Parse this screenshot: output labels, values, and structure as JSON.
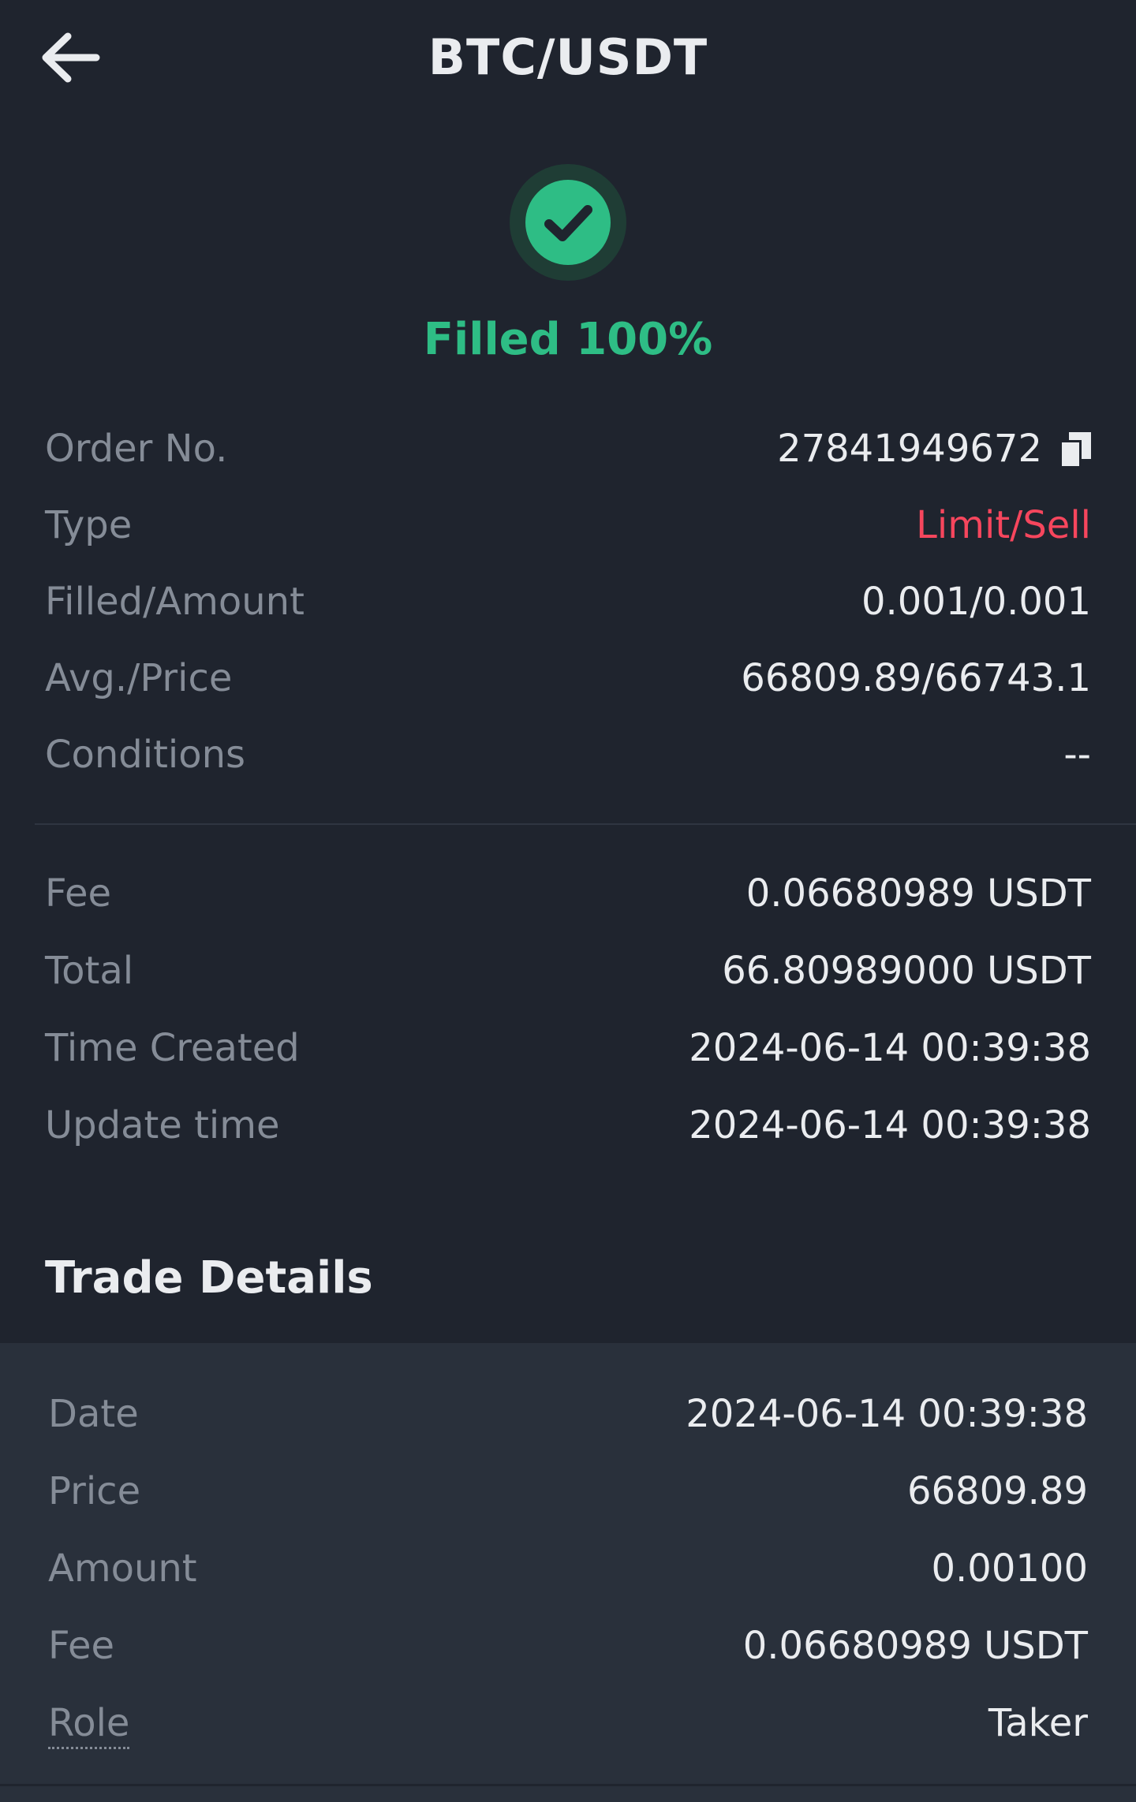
{
  "header": {
    "title": "BTC/USDT"
  },
  "status": {
    "label": "Filled 100%",
    "color": "#2ebd85"
  },
  "order": {
    "rows": [
      {
        "label": "Order No.",
        "value": "27841949672"
      },
      {
        "label": "Type",
        "value": "Limit/Sell"
      },
      {
        "label": "Filled/Amount",
        "value": "0.001/0.001"
      },
      {
        "label": "Avg./Price",
        "value": "66809.89/66743.1"
      },
      {
        "label": "Conditions",
        "value": "--"
      }
    ]
  },
  "summary": {
    "rows": [
      {
        "label": "Fee",
        "value": "0.06680989 USDT"
      },
      {
        "label": "Total",
        "value": "66.80989000 USDT"
      },
      {
        "label": "Time Created",
        "value": "2024-06-14 00:39:38"
      },
      {
        "label": "Update time",
        "value": "2024-06-14 00:39:38"
      }
    ]
  },
  "trade_details": {
    "title": "Trade Details",
    "rows": [
      {
        "label": "Date",
        "value": "2024-06-14 00:39:38"
      },
      {
        "label": "Price",
        "value": "66809.89"
      },
      {
        "label": "Amount",
        "value": "0.00100"
      },
      {
        "label": "Fee",
        "value": "0.06680989 USDT"
      },
      {
        "label": "Role",
        "value": "Taker"
      }
    ]
  },
  "colors": {
    "background": "#1f242e",
    "panel": "#29303b",
    "sell": "#f6465d",
    "success": "#2ebd85"
  }
}
